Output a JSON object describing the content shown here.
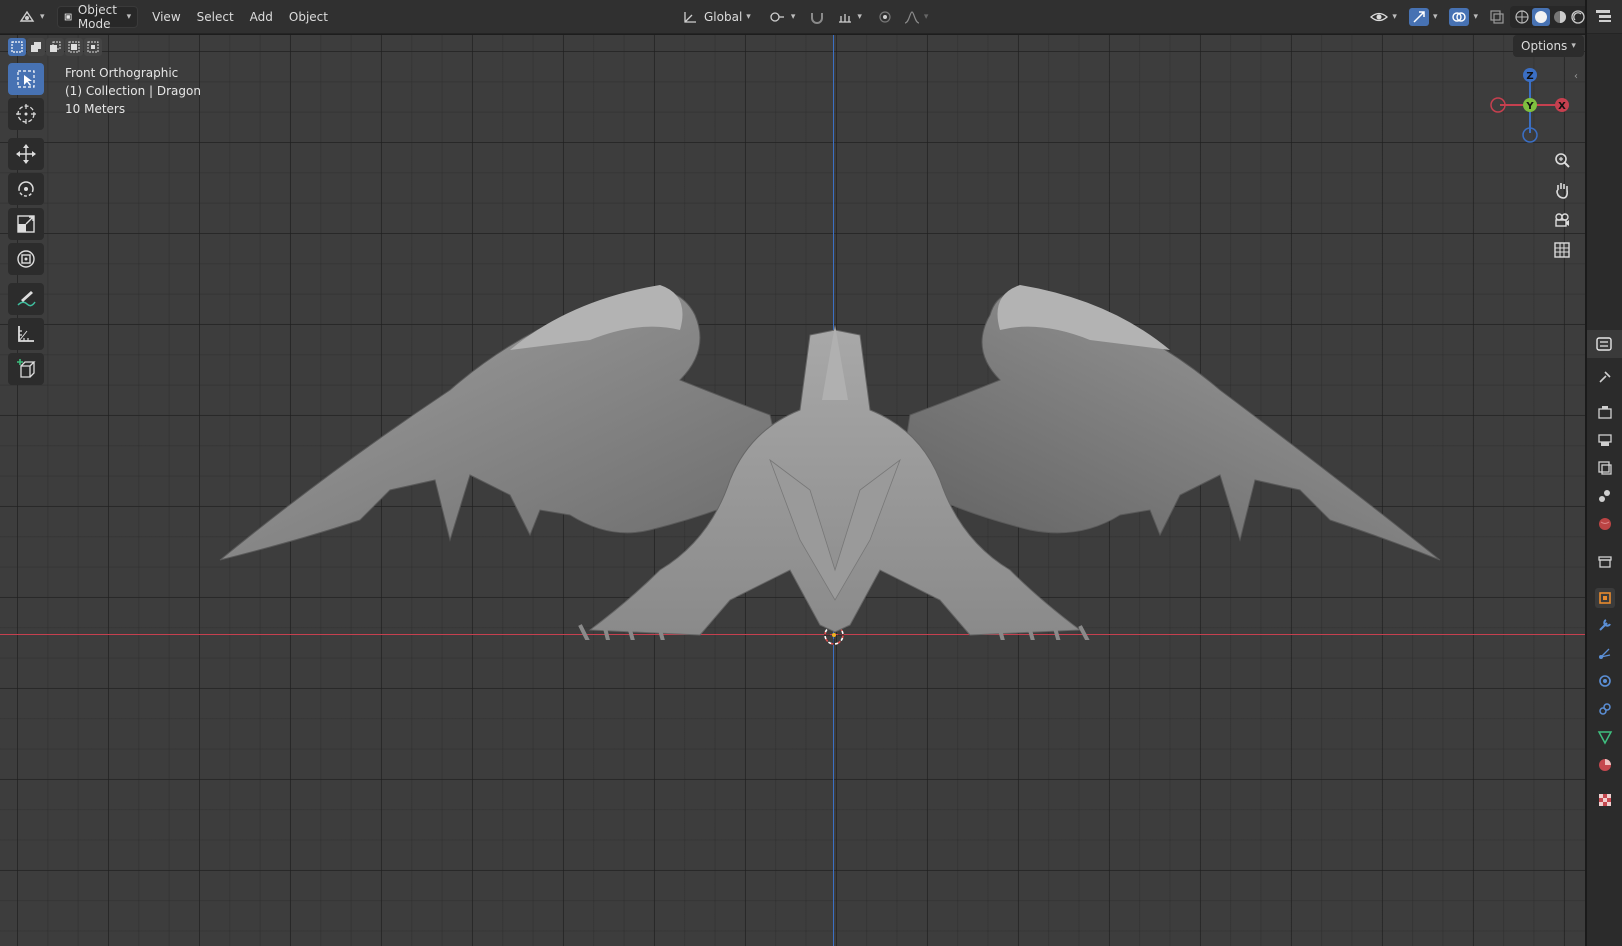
{
  "header": {
    "editor_type_icon": "3d-viewport-icon",
    "mode_label": "Object Mode",
    "menus": [
      "View",
      "Select",
      "Add",
      "Object"
    ],
    "orientation_label": "Global"
  },
  "viewport": {
    "view_name": "Front Orthographic",
    "collection_line": "(1) Collection | Dragon",
    "scale_line": "10 Meters",
    "options_label": "Options",
    "gizmo": {
      "z_label": "Z",
      "y_label": "Y",
      "x_label": "X"
    }
  },
  "colors": {
    "x_axis": "#c6404f",
    "z_axis": "#3b6fc4",
    "active_tool": "#4772b3",
    "model": "#8e8e8e"
  },
  "toolbar": {
    "tools": [
      "select-box-icon",
      "cursor-icon",
      "move-icon",
      "rotate-icon",
      "scale-icon",
      "transform-icon",
      "annotate-icon",
      "measure-icon",
      "add-cube-icon"
    ]
  },
  "properties_tabs": [
    "tool-icon",
    "render-icon",
    "output-icon",
    "view-layer-icon",
    "scene-icon",
    "world-icon",
    "collection-icon",
    "object-icon",
    "modifier-icon",
    "particles-icon",
    "physics-icon",
    "constraints-icon",
    "data-icon",
    "material-icon",
    "texture-icon"
  ]
}
